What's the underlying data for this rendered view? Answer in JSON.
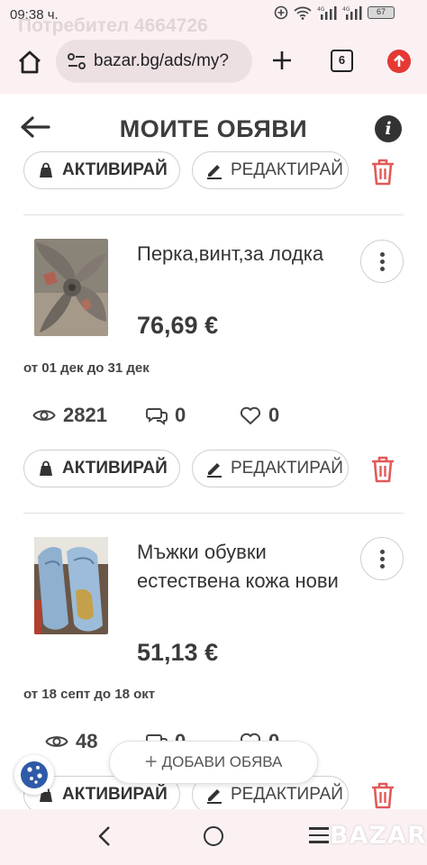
{
  "status_bar": {
    "time": "09:38 ч.",
    "battery": "67"
  },
  "ghost_text": "Потребител 4664726",
  "browser": {
    "url": "bazar.bg/ads/my?",
    "tab_count": "6"
  },
  "header": {
    "title": "МОИТЕ ОБЯВИ"
  },
  "buttons": {
    "activate": "АКТИВИРАЙ",
    "edit": "РЕДАКТИРАЙ"
  },
  "listings": [
    {
      "title": "Перка,винт,за лодка",
      "price": "76,69 €",
      "dates": "от 01 дек до 31 дек",
      "views": "2821",
      "messages": "0",
      "favorites": "0"
    },
    {
      "title": "Мъжки обувки естествена кожа нови",
      "price": "51,13 €",
      "dates": "от 18 септ до 18 окт",
      "views": "48",
      "messages": "0",
      "favorites": "0"
    }
  ],
  "add_ad": {
    "label": "ДОБАВИ ОБЯВА"
  },
  "watermark": "BAZAR",
  "colors": {
    "accent_red": "#e05a5a",
    "chrome_bg": "#fbf1f3"
  }
}
